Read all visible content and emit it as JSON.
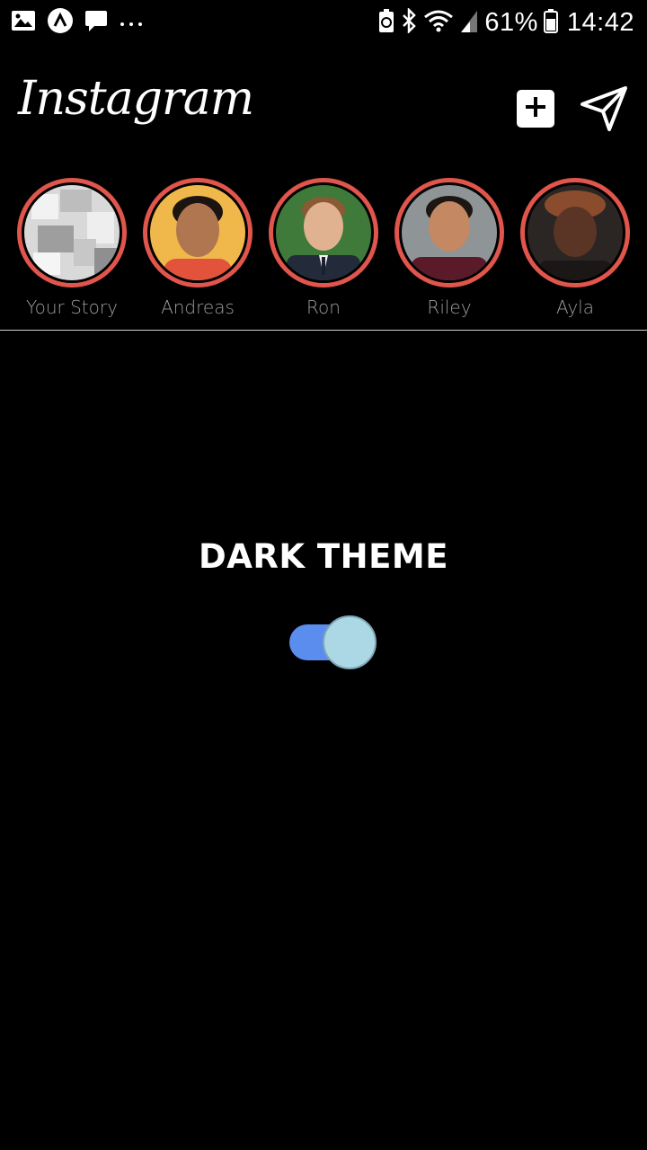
{
  "status_bar": {
    "battery": "61%",
    "time": "14:42",
    "icons": [
      "image-icon",
      "app-icon",
      "message-icon",
      "more-dots-icon",
      "battery-saver-icon",
      "bluetooth-icon",
      "wifi-icon",
      "signal-icon",
      "battery-icon"
    ]
  },
  "header": {
    "logo": "Instagram",
    "new_post_icon": "plus-square-icon",
    "direct_icon": "paper-plane-icon"
  },
  "stories": [
    {
      "label": "Your Story"
    },
    {
      "label": "Andreas"
    },
    {
      "label": "Ron"
    },
    {
      "label": "Riley"
    },
    {
      "label": "Ayla"
    }
  ],
  "main": {
    "title": "DARK THEME",
    "toggle_on": true
  },
  "colors": {
    "background": "#000000",
    "story_ring": "#e0554c",
    "toggle_track": "#5b8def",
    "toggle_knob": "#acd8e6",
    "label_gray": "#9c9c9c"
  }
}
